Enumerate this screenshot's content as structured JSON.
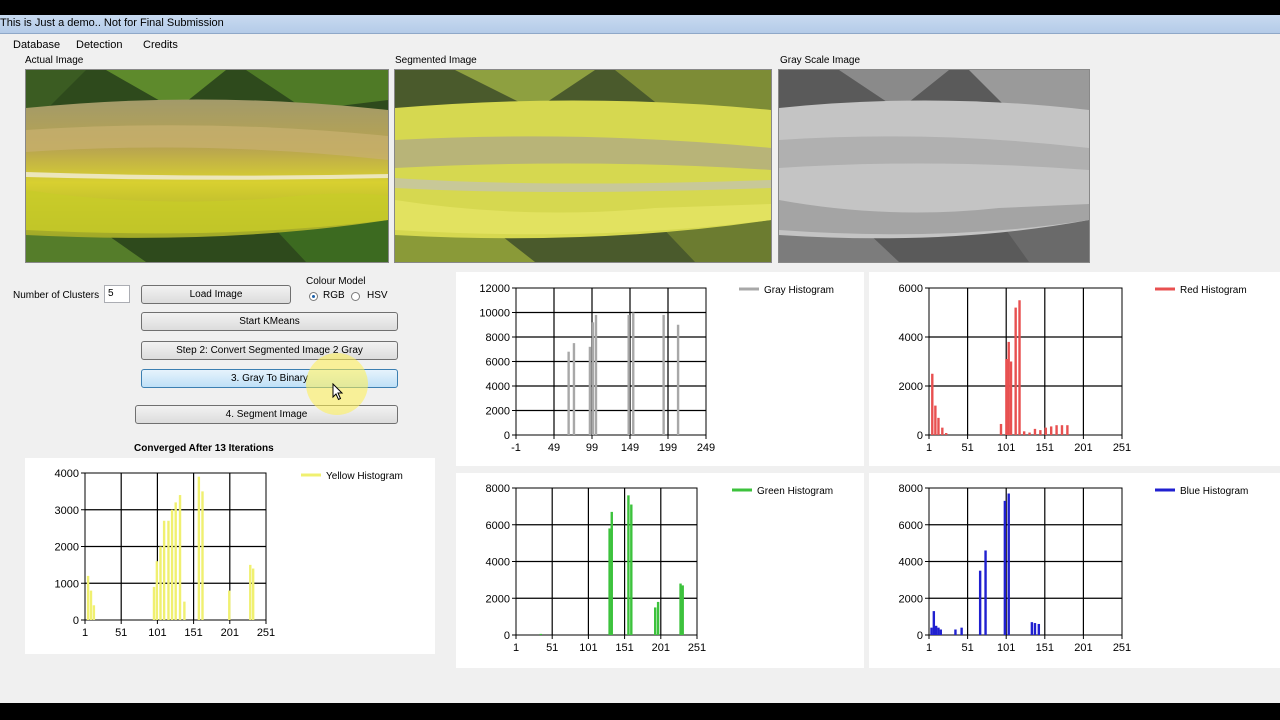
{
  "window": {
    "title": "This is Just a demo.. Not for Final Submission"
  },
  "menu": {
    "items": [
      "Database",
      "Detection",
      "Credits"
    ]
  },
  "images": {
    "actual_label": "Actual Image",
    "segmented_label": "Segmented Image",
    "gray_label": "Gray Scale Image"
  },
  "controls": {
    "clusters_label": "Number of Clusters",
    "clusters_value": "5",
    "colour_model_label": "Colour Model",
    "rgb_label": "RGB",
    "hsv_label": "HSV",
    "selected_model": "RGB",
    "load_image": "Load Image",
    "start_kmeans": "Start KMeans",
    "step2": "Step 2: Convert Segmented Image 2 Gray",
    "step3": "3. Gray To Binary",
    "step4": "4. Segment Image",
    "status": "Converged After 13 Iterations"
  },
  "colors": {
    "gray": "#a8a8a8",
    "red": "#e85050",
    "green": "#3cc23c",
    "blue": "#2020d0",
    "yellow": "#f0f070"
  },
  "chart_data": [
    {
      "id": "gray",
      "type": "bar",
      "legend": "Gray Histogram",
      "color": "#a8a8a8",
      "xlim": [
        -1,
        249
      ],
      "ylim": [
        0,
        12000
      ],
      "xticks": [
        -1,
        49,
        99,
        149,
        199,
        249
      ],
      "yticks": [
        0,
        2000,
        4000,
        6000,
        8000,
        10000,
        12000
      ],
      "x": [
        68,
        75,
        96,
        100,
        104,
        147,
        153,
        193,
        212
      ],
      "values": [
        6800,
        7500,
        7200,
        9200,
        9800,
        9800,
        10000,
        9800,
        9000
      ]
    },
    {
      "id": "red",
      "type": "bar",
      "legend": "Red Histogram",
      "color": "#e85050",
      "xlim": [
        1,
        251
      ],
      "ylim": [
        0,
        6000
      ],
      "xticks": [
        1,
        51,
        101,
        151,
        201,
        251
      ],
      "yticks": [
        0,
        2000,
        4000,
        6000
      ],
      "x": [
        5,
        9,
        13,
        18,
        23,
        94,
        101,
        104,
        107,
        113,
        118,
        124,
        131,
        138,
        145,
        152,
        159,
        166,
        173,
        180
      ],
      "values": [
        2500,
        1200,
        700,
        300,
        80,
        450,
        3100,
        3800,
        3000,
        5200,
        5500,
        150,
        100,
        250,
        200,
        300,
        350,
        400,
        400,
        400
      ]
    },
    {
      "id": "green",
      "type": "bar",
      "legend": "Green Histogram",
      "color": "#3cc23c",
      "xlim": [
        1,
        251
      ],
      "ylim": [
        0,
        8000
      ],
      "xticks": [
        1,
        51,
        101,
        151,
        201,
        251
      ],
      "yticks": [
        0,
        2000,
        4000,
        6000,
        8000
      ],
      "x": [
        35,
        130,
        133,
        156,
        160,
        193,
        197,
        228,
        231
      ],
      "values": [
        60,
        5800,
        6700,
        7600,
        7100,
        1500,
        1800,
        2800,
        2700
      ]
    },
    {
      "id": "blue",
      "type": "bar",
      "legend": "Blue Histogram",
      "color": "#2020d0",
      "xlim": [
        1,
        251
      ],
      "ylim": [
        0,
        8000
      ],
      "xticks": [
        1,
        51,
        101,
        151,
        201,
        251
      ],
      "yticks": [
        0,
        2000,
        4000,
        6000,
        8000
      ],
      "x": [
        4,
        7,
        10,
        13,
        16,
        35,
        43,
        67,
        74,
        99,
        104,
        134,
        138,
        143
      ],
      "values": [
        400,
        1300,
        500,
        400,
        300,
        300,
        400,
        3500,
        4600,
        7300,
        7700,
        700,
        650,
        600
      ]
    },
    {
      "id": "yellow",
      "type": "bar",
      "legend": "Yellow Histogram",
      "color": "#f0f070",
      "xlim": [
        1,
        251
      ],
      "ylim": [
        0,
        4000
      ],
      "xticks": [
        1,
        51,
        101,
        151,
        201,
        251
      ],
      "yticks": [
        0,
        1000,
        2000,
        3000,
        4000
      ],
      "x": [
        5,
        9,
        13,
        96,
        100,
        105,
        110,
        116,
        121,
        126,
        132,
        138,
        158,
        163,
        200,
        229,
        233
      ],
      "values": [
        1200,
        800,
        400,
        900,
        1600,
        2000,
        2700,
        2700,
        3000,
        3200,
        3400,
        500,
        3900,
        3500,
        800,
        1500,
        1400
      ]
    }
  ]
}
